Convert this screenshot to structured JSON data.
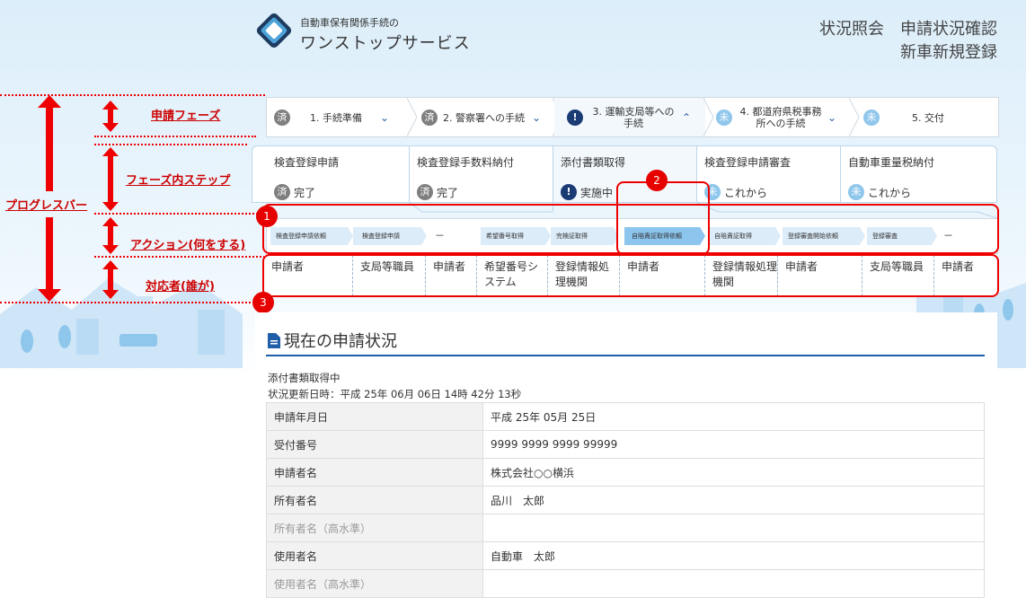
{
  "header": {
    "logo_line1": "自動車保有関係手続の",
    "logo_line2": "ワンストップサービス",
    "title_a": "状況照会",
    "title_b": "申請状況確認",
    "title_c": "新車新規登録"
  },
  "annotations": {
    "progress_bar": "プログレスバー",
    "phase": "申請フェーズ",
    "step_in_phase": "フェーズ内ステップ",
    "action": "アクション(何をする)",
    "actor": "対応者(誰が)",
    "marker1": "1",
    "marker2": "2",
    "marker3": "3"
  },
  "phases": [
    {
      "badge": "済",
      "label": "1. 手続準備",
      "chevron": "⌄",
      "badge_color": "#7f7f7f"
    },
    {
      "badge": "済",
      "label": "2. 警察署への手続",
      "chevron": "⌄",
      "badge_color": "#7f7f7f"
    },
    {
      "badge": "!",
      "label": "3. 運輸支局等への手続",
      "chevron": "⌃",
      "badge_color": "#1a3b73"
    },
    {
      "badge": "未",
      "label": "4. 都道府県税事務所への手続",
      "chevron": "⌄",
      "badge_color": "#8ec6ec"
    },
    {
      "badge": "未",
      "label": "5. 交付",
      "chevron": "",
      "badge_color": "#8ec6ec"
    }
  ],
  "steps": [
    {
      "title": "検査登録申請",
      "badge": "済",
      "status": "完了",
      "badge_color": "#7f7f7f"
    },
    {
      "title": "検査登録手数料納付",
      "badge": "済",
      "status": "完了",
      "badge_color": "#7f7f7f"
    },
    {
      "title": "添付書類取得",
      "badge": "!",
      "status": "実施中",
      "badge_color": "#1a3b73"
    },
    {
      "title": "検査登録申請審査",
      "badge": "未",
      "status": "これから",
      "badge_color": "#8ec6ec"
    },
    {
      "title": "自動車重量税納付",
      "badge": "未",
      "status": "これから",
      "badge_color": "#8ec6ec"
    }
  ],
  "actions": [
    "検査登録申請依頼",
    "検査登録申請",
    "－",
    "希望番号取得",
    "完検証取得",
    "自賠責証取得依頼",
    "自賠責証取得",
    "登録審査開始依頼",
    "登録審査",
    "－"
  ],
  "actors": [
    "申請者",
    "支局等職員",
    "申請者",
    "希望番号システム",
    "登録情報処理機関",
    "申請者",
    "登録情報処理機関",
    "申請者",
    "支局等職員",
    "申請者"
  ],
  "status": {
    "title": "現在の申請状況",
    "line1": "添付書類取得中",
    "line2": "状況更新日時：平成 25年 06月 06日 14時 42分 13秒",
    "rows": [
      {
        "key": "申請年月日",
        "value": "平成 25年 05月 25日"
      },
      {
        "key": "受付番号",
        "value": "9999 9999 9999 99999"
      },
      {
        "key": "申請者名",
        "value": "株式会社○○横浜"
      },
      {
        "key": "所有者名",
        "value": "品川　太郎"
      },
      {
        "key": "所有者名（高水準）",
        "value": ""
      },
      {
        "key": "使用者名",
        "value": "自動車　太郎"
      },
      {
        "key": "使用者名（高水準）",
        "value": ""
      }
    ]
  }
}
